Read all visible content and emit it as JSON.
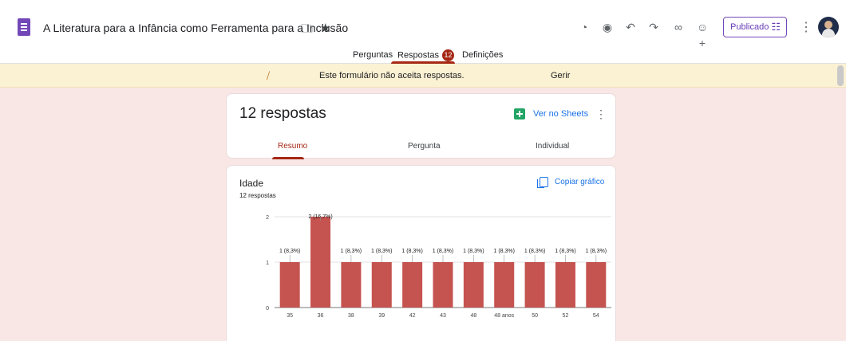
{
  "header": {
    "title": "A Literatura para a Infância  como Ferramenta para a Inclusão",
    "publish_label": "Publicado",
    "icons": [
      "palette-icon",
      "preview-eye-icon",
      "undo-icon",
      "redo-icon",
      "link-icon",
      "add-collaborator-icon",
      "more-vert-icon"
    ]
  },
  "tabs": [
    {
      "label": "Perguntas"
    },
    {
      "label": "Respostas",
      "badge": "12"
    },
    {
      "label": "Definições"
    }
  ],
  "notice": {
    "text": "Este formulário não aceita respostas.",
    "action": "Gerir"
  },
  "summary": {
    "count_label": "12 respostas",
    "sheets_label": "Ver no Sheets",
    "subtabs": [
      "Resumo",
      "Pergunta",
      "Individual"
    ]
  },
  "question": {
    "title": "Idade",
    "responses": "12 respostas",
    "copy_label": "Copiar gráfico"
  },
  "colors": {
    "accent": "#a52714",
    "bar": "#c5534f",
    "background": "#f9e7e6",
    "form_purple": "#7248b9",
    "link_blue": "#1a73e8"
  },
  "chart_data": {
    "type": "bar",
    "categories": [
      "35",
      "36",
      "38",
      "39",
      "42",
      "43",
      "48",
      "48 anos",
      "50",
      "52",
      "54"
    ],
    "values": [
      1,
      2,
      1,
      1,
      1,
      1,
      1,
      1,
      1,
      1,
      1
    ],
    "data_labels": [
      "1 (8,3%)",
      "2 (16,7%)",
      "1 (8,3%)",
      "1 (8,3%)",
      "1 (8,3%)",
      "1 (8,3%)",
      "1 (8,3%)",
      "1 (8,3%)",
      "1 (8,3%)",
      "1 (8,3%)",
      "1 (8,3%)"
    ],
    "yticks": [
      "0",
      "1",
      "2"
    ],
    "ylim": [
      0,
      2
    ],
    "grid": true
  }
}
